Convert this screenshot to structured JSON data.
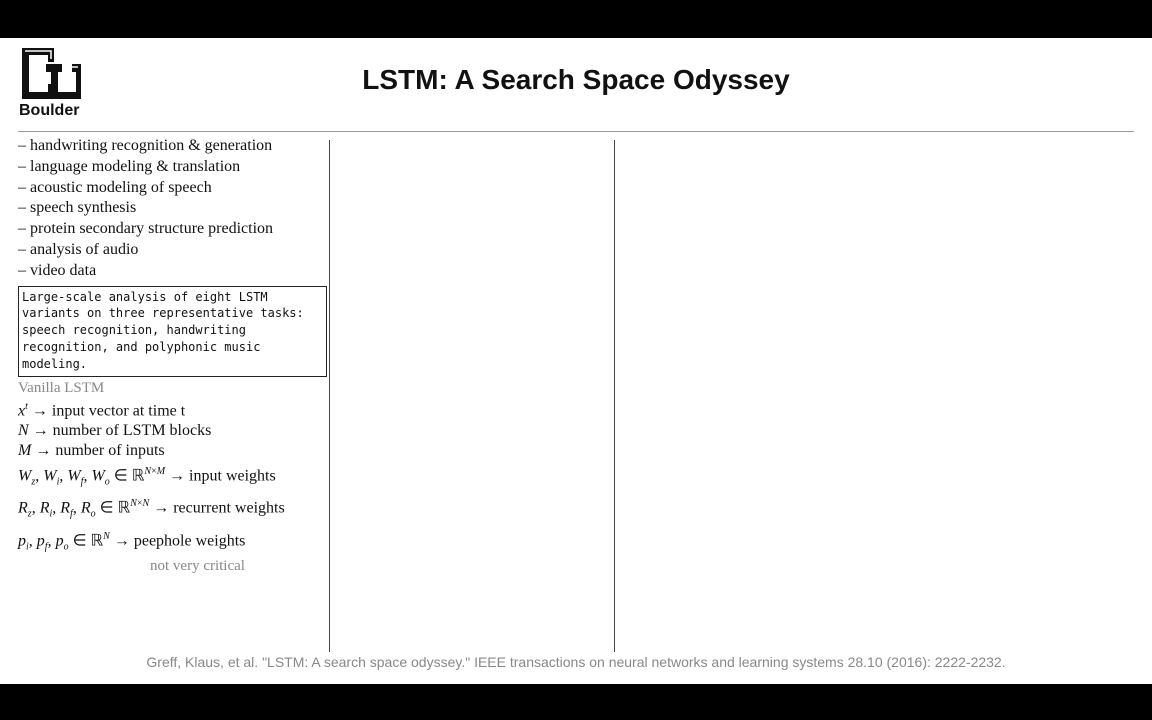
{
  "header": {
    "title": "LSTM: A Search Space Odyssey",
    "logo_text": "Boulder"
  },
  "notes": {
    "bullets": [
      "– handwriting recognition & generation",
      "– language modeling & translation",
      "– acoustic modeling of speech",
      "– speech synthesis",
      "– protein secondary structure prediction",
      "– analysis of audio",
      "– video data"
    ],
    "boxed_text_lines": [
      "Large-scale analysis of eight LSTM",
      "variants on three representative tasks:",
      "speech recognition, handwriting",
      "recognition, and polyphonic music",
      "modeling."
    ],
    "vanilla_heading": "Vanilla LSTM",
    "defs": {
      "d1_desc": "input vector at time t",
      "d2_desc": "number of LSTM blocks",
      "d3_desc": "number of inputs",
      "d4_desc": "input weights",
      "d5_desc": "recurrent weights",
      "d6_desc": "peephole weights",
      "d6_note": "not very critical"
    }
  },
  "footer": {
    "citation": "Greff, Klaus, et al. \"LSTM: A search space odyssey.\" IEEE transactions on neural networks and learning systems 28.10 (2016): 2222-2232."
  },
  "colors": {
    "annotation_gray": "#888888",
    "rule": "#999999"
  }
}
